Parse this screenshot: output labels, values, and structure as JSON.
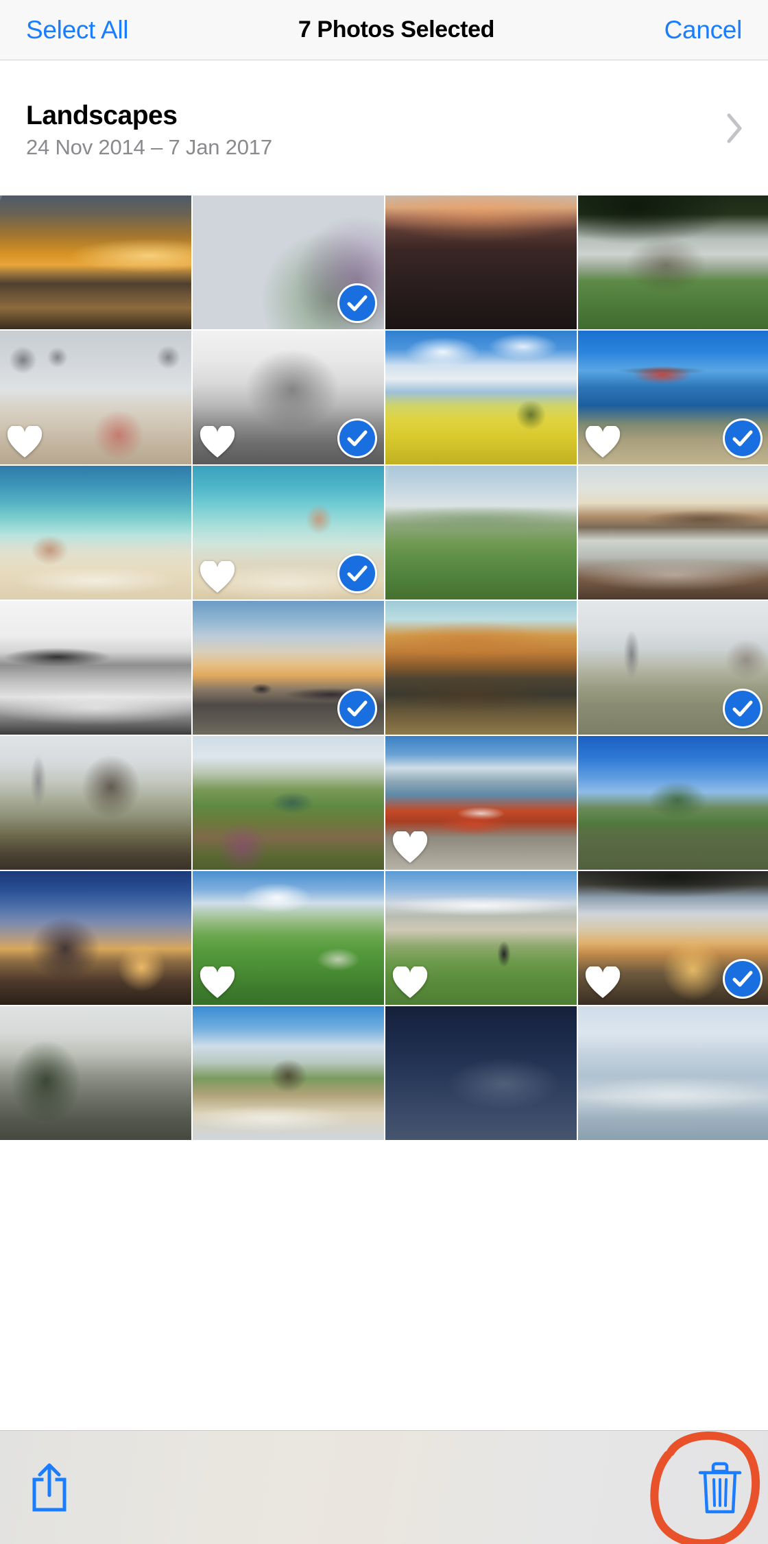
{
  "navbar": {
    "select_all_label": "Select All",
    "title": "7 Photos Selected",
    "cancel_label": "Cancel",
    "tint_color": "#1a7cff",
    "background": "#f8f8f8"
  },
  "album": {
    "title": "Landscapes",
    "date_range": "24 Nov 2014 – 7 Jan 2017",
    "disclosure_icon": "chevron-right-icon"
  },
  "grid": {
    "columns": 4,
    "rows": 7,
    "selected_count": 7,
    "selection_badge_color": "#1a6fe0",
    "favorite_badge_color": "#ffffff",
    "tiles": [
      {
        "row": 1,
        "col": 1,
        "alt": "Golden sunset over sea with boat",
        "selected": false,
        "favorite": false
      },
      {
        "row": 1,
        "col": 2,
        "alt": "Purple flowers beside pale beach",
        "selected": true,
        "favorite": false
      },
      {
        "row": 1,
        "col": 3,
        "alt": "Dark choppy sea at dusk with bird",
        "selected": false,
        "favorite": false
      },
      {
        "row": 1,
        "col": 4,
        "alt": "Lone tree in green field under trees",
        "selected": false,
        "favorite": false
      },
      {
        "row": 2,
        "col": 1,
        "alt": "Child on beach with gulls overhead",
        "selected": false,
        "favorite": true
      },
      {
        "row": 2,
        "col": 2,
        "alt": "Black and white tree on hillside",
        "selected": true,
        "favorite": true
      },
      {
        "row": 2,
        "col": 3,
        "alt": "Yellow rapeseed field under blue sky",
        "selected": false,
        "favorite": false
      },
      {
        "row": 2,
        "col": 4,
        "alt": "Red rescue helicopter over coast",
        "selected": true,
        "favorite": true
      },
      {
        "row": 3,
        "col": 1,
        "alt": "Person sitting in turquoise surf",
        "selected": false,
        "favorite": false
      },
      {
        "row": 3,
        "col": 2,
        "alt": "Person wading in clear shallow sea",
        "selected": true,
        "favorite": true
      },
      {
        "row": 3,
        "col": 3,
        "alt": "Green rolling farmland",
        "selected": false,
        "favorite": false
      },
      {
        "row": 3,
        "col": 4,
        "alt": "Town across bay at golden hour",
        "selected": false,
        "favorite": false
      },
      {
        "row": 4,
        "col": 1,
        "alt": "Black and white shoreline town",
        "selected": false,
        "favorite": false
      },
      {
        "row": 4,
        "col": 2,
        "alt": "Drone over sunset beach",
        "selected": true,
        "favorite": false
      },
      {
        "row": 4,
        "col": 3,
        "alt": "Autumn trees reflected in lake",
        "selected": false,
        "favorite": false
      },
      {
        "row": 4,
        "col": 4,
        "alt": "Snowy field with pylon and fence",
        "selected": true,
        "favorite": false
      },
      {
        "row": 5,
        "col": 1,
        "alt": "Frosty field with gate and pylon",
        "selected": false,
        "favorite": false
      },
      {
        "row": 5,
        "col": 2,
        "alt": "Upturned boat in wildflower meadow",
        "selected": false,
        "favorite": false
      },
      {
        "row": 5,
        "col": 3,
        "alt": "Red fishing boat on estuary shore",
        "selected": false,
        "favorite": true
      },
      {
        "row": 5,
        "col": 4,
        "alt": "Tree and stone wall under blue sky",
        "selected": false,
        "favorite": false
      },
      {
        "row": 6,
        "col": 1,
        "alt": "Silhouetted tree at blue sunset",
        "selected": false,
        "favorite": false
      },
      {
        "row": 6,
        "col": 2,
        "alt": "Green track between stone walls",
        "selected": false,
        "favorite": true
      },
      {
        "row": 6,
        "col": 3,
        "alt": "Walkers on dune path above beach",
        "selected": false,
        "favorite": true
      },
      {
        "row": 6,
        "col": 4,
        "alt": "Sunset through dark tree canopy",
        "selected": true,
        "favorite": true
      },
      {
        "row": 7,
        "col": 1,
        "alt": "Tree against overcast sky",
        "selected": false,
        "favorite": false
      },
      {
        "row": 7,
        "col": 2,
        "alt": "Castle on dunes above beach",
        "selected": false,
        "favorite": false
      },
      {
        "row": 7,
        "col": 3,
        "alt": "Dark blue night clouds",
        "selected": false,
        "favorite": false
      },
      {
        "row": 7,
        "col": 4,
        "alt": "Pale cloudy sky over sea",
        "selected": false,
        "favorite": false
      }
    ]
  },
  "toolbar": {
    "share_icon": "share-icon",
    "trash_icon": "trash-icon",
    "tint_color": "#1a7cff",
    "annotation": {
      "shape": "hand-drawn-circle",
      "color": "#e8512a",
      "targets": "trash-icon"
    }
  }
}
